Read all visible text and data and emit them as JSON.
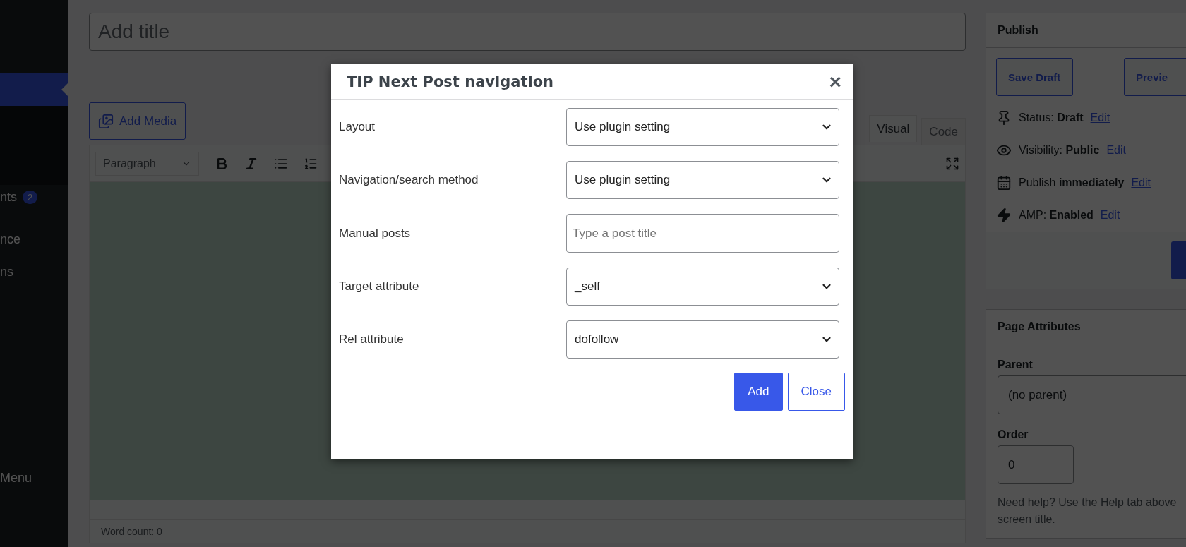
{
  "sidebar": {
    "items": [
      {
        "selected": true
      },
      {
        "label": "nts",
        "badge": "2",
        "selected": false
      },
      {
        "label": "nce",
        "selected": false
      },
      {
        "label": "ns",
        "selected": false
      },
      {
        "label": "Menu",
        "selected": false
      }
    ]
  },
  "editor": {
    "title_placeholder": "Add title",
    "add_media": "Add Media",
    "format": "Paragraph",
    "tabs": [
      {
        "label": "Visual",
        "selected": true
      },
      {
        "label": "Code",
        "selected": false
      }
    ],
    "word_count": "Word count: 0"
  },
  "publish": {
    "title": "Publish",
    "buttons": [
      "Save Draft",
      "Previe"
    ],
    "meta": [
      {
        "kind": "status",
        "text": "Status: **Draft**",
        "link": "Edit"
      },
      {
        "kind": "visibility",
        "text": "Visibility: **Public**",
        "link": "Edit"
      },
      {
        "kind": "schedule",
        "text": "Publish **immediately**",
        "link": "Edit"
      },
      {
        "kind": "amp",
        "text": "AMP: **Enabled**",
        "link": "Edit"
      }
    ]
  },
  "page_attributes": {
    "title": "Page Attributes",
    "parent_label": "Parent",
    "parent_value": "(no parent)",
    "order_label": "Order",
    "order_value": "0",
    "help": [
      "Need help? Use the Help tab above",
      "screen title."
    ]
  },
  "modal": {
    "title": "TIP Next Post navigation",
    "close": "×",
    "fields": [
      {
        "label": "Layout",
        "kind": "select",
        "value": "Use plugin setting"
      },
      {
        "label": "Navigation/search method",
        "kind": "select",
        "value": "Use plugin setting"
      },
      {
        "label": "Manual posts",
        "kind": "input",
        "placeholder": "Type a post title"
      },
      {
        "label": "Target attribute",
        "kind": "select",
        "value": "_self"
      },
      {
        "label": "Rel attribute",
        "kind": "select",
        "value": "dofollow"
      }
    ],
    "buttons": [
      {
        "label": "Add",
        "kind": "primary"
      },
      {
        "label": "Close",
        "kind": "secondary"
      }
    ]
  }
}
